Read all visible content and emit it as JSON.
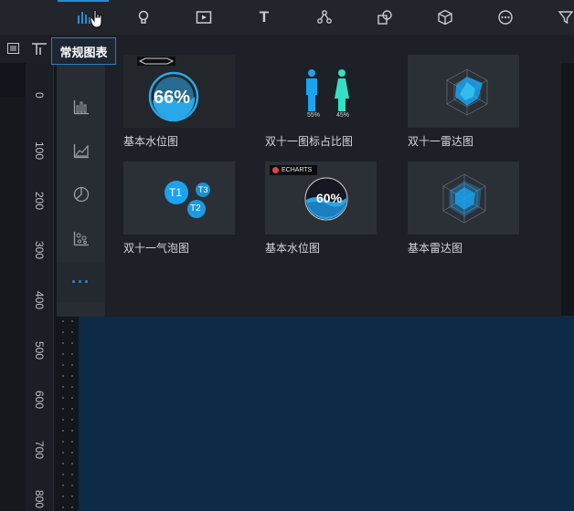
{
  "toolbar": {
    "items": [
      {
        "icon": "bar-chart-icon",
        "active": true
      },
      {
        "icon": "lightbulb-icon"
      },
      {
        "icon": "media-play-icon"
      },
      {
        "icon": "text-icon",
        "glyph": "T"
      },
      {
        "icon": "relation-graph-icon"
      },
      {
        "icon": "shapes-icon"
      },
      {
        "icon": "cube-icon"
      },
      {
        "icon": "more-circle-icon"
      },
      {
        "icon": "filter-icon"
      }
    ],
    "accent": "#2a8bd5"
  },
  "category_tooltip": "常规图表",
  "categories": [
    {
      "icon": "bar-chart-icon"
    },
    {
      "icon": "line-area-chart-icon"
    },
    {
      "icon": "pie-chart-icon"
    },
    {
      "icon": "scatter-chart-icon"
    },
    {
      "icon": "more-dots-icon",
      "glyph": "···",
      "active": true
    }
  ],
  "charts": [
    {
      "label": "基本水位图",
      "thumb_text": "66%"
    },
    {
      "label": "双十一图标占比图",
      "thumb_values": [
        "55%",
        "45%"
      ]
    },
    {
      "label": "双十一雷达图"
    },
    {
      "label": "双十一气泡图",
      "bubbles": [
        "T1",
        "T3",
        "T2"
      ]
    },
    {
      "label": "基本水位图",
      "thumb_text": "60%",
      "badge": "ECHARTS"
    },
    {
      "label": "基本雷达图"
    }
  ],
  "ruler": {
    "ticks": [
      "0",
      "100",
      "200",
      "300",
      "400",
      "500",
      "600",
      "700",
      "800"
    ]
  },
  "colors": {
    "canvas": "#0d2a47",
    "panel": "#1d2026",
    "water": "#2aa7e6",
    "male": "#1aa3f0",
    "female": "#33e0c3"
  }
}
